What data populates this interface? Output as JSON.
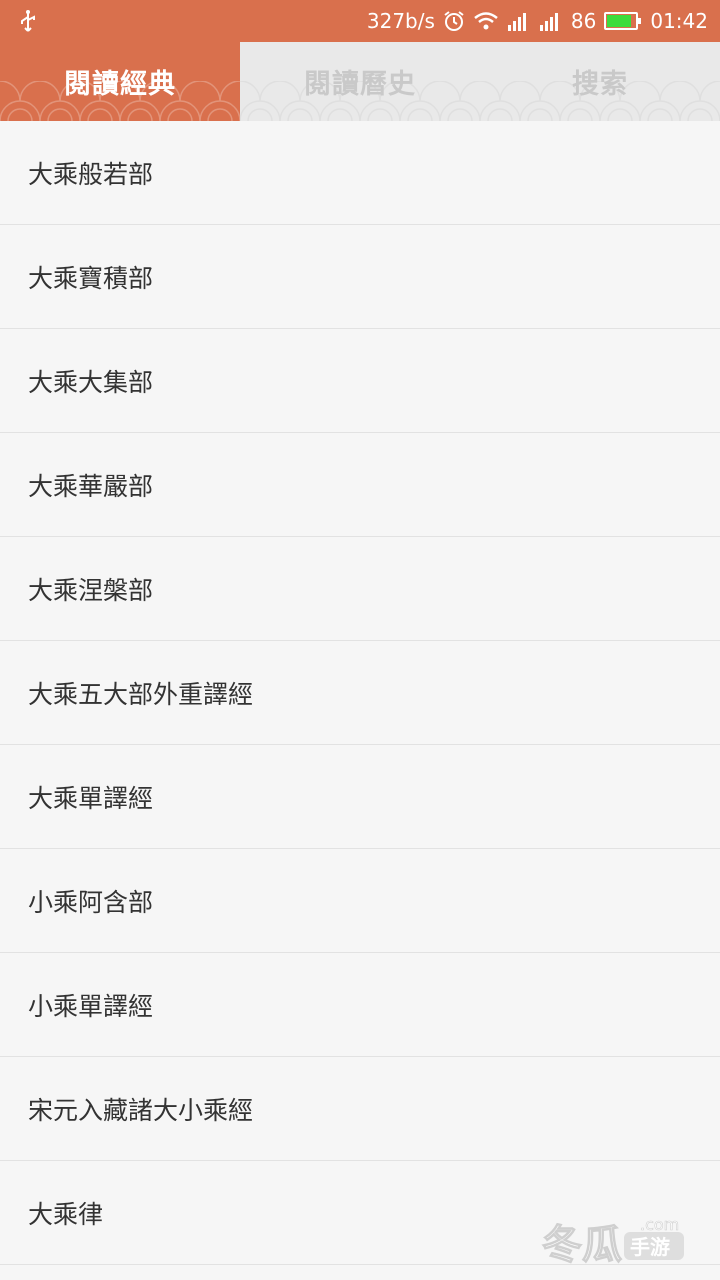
{
  "status_bar": {
    "speed": "327b/s",
    "battery": "86",
    "time": "01:42",
    "battery_level": 0.86,
    "bg_color": "#d9704d",
    "battery_color": "#3ddc3d"
  },
  "tabs": [
    {
      "label": "閱讀經典",
      "active": true
    },
    {
      "label": "閱讀曆史",
      "active": false
    },
    {
      "label": "搜索",
      "active": false
    }
  ],
  "list": [
    "大乘般若部",
    "大乘寶積部",
    "大乘大集部",
    "大乘華嚴部",
    "大乘涅槃部",
    "大乘五大部外重譯經",
    "大乘單譯經",
    "小乘阿含部",
    "小乘單譯經",
    "宋元入藏諸大小乘經",
    "大乘律"
  ],
  "watermark": {
    "text": "冬瓜",
    "sub": "手游",
    "domain": ".com"
  },
  "colors": {
    "accent": "#d9704d",
    "tab_inactive_bg": "#e9e9e9",
    "tab_inactive_text": "#c9c9c9",
    "list_bg": "#f6f6f6",
    "divider": "#e2e2e2"
  }
}
